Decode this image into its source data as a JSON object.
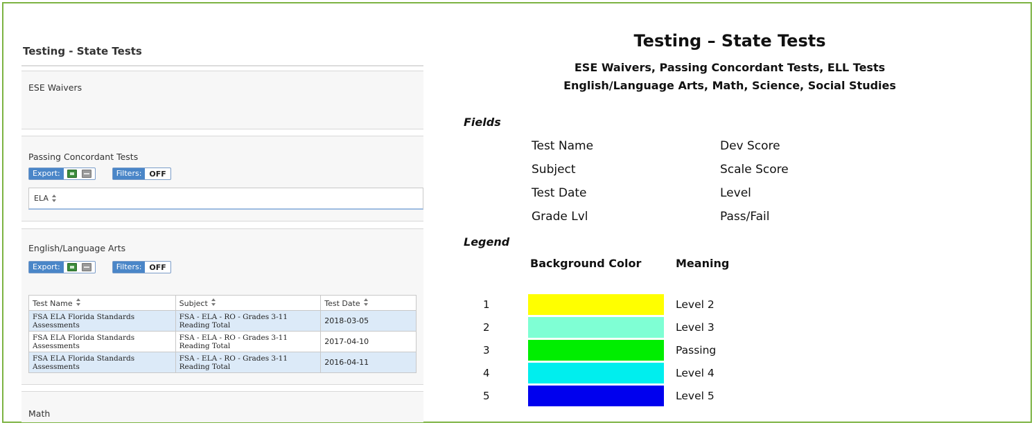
{
  "left_panel": {
    "page_title": "Testing - State Tests",
    "sections": {
      "ese_waivers": {
        "title": "ESE Waivers"
      },
      "passing_concordant": {
        "title": "Passing Concordant Tests",
        "export_label": "Export:",
        "filters_label": "Filters:",
        "filters_value": "OFF",
        "column": "ELA"
      },
      "english": {
        "title": "English/Language Arts",
        "export_label": "Export:",
        "filters_label": "Filters:",
        "filters_value": "OFF",
        "columns": [
          "Test Name",
          "Subject",
          "Test Date"
        ],
        "rows": [
          {
            "test_name": "FSA ELA Florida Standards Assessments",
            "subject": "FSA - ELA - RO - Grades 3-11 Reading Total",
            "test_date": "2018-03-05"
          },
          {
            "test_name": "FSA ELA Florida Standards Assessments",
            "subject": "FSA - ELA - RO - Grades 3-11 Reading Total",
            "test_date": "2017-04-10"
          },
          {
            "test_name": "FSA ELA Florida Standards Assessments",
            "subject": "FSA - ELA - RO - Grades 3-11 Reading Total",
            "test_date": "2016-04-11"
          }
        ]
      },
      "math": {
        "title": "Math"
      }
    },
    "icons": [
      "excel-export-icon",
      "print-icon",
      "sort-icon"
    ]
  },
  "right_panel": {
    "title": "Testing – State Tests",
    "subtitle_1": "ESE Waivers, Passing Concordant Tests, ELL Tests",
    "subtitle_2": "English/Language Arts, Math, Science, Social Studies",
    "fields_heading": "Fields",
    "fields_col1": [
      "Test Name",
      "Subject",
      "Test Date",
      "Grade Lvl"
    ],
    "fields_col2": [
      "Dev Score",
      "Scale Score",
      "Level",
      "Pass/Fail"
    ],
    "legend_heading": "Legend",
    "legend_col_color": "Background Color",
    "legend_col_meaning": "Meaning",
    "legend": [
      {
        "num": "1",
        "color": "#ffff00",
        "meaning": "Level 2"
      },
      {
        "num": "2",
        "color": "#7fffd4",
        "meaning": "Level 3"
      },
      {
        "num": "3",
        "color": "#00ee00",
        "meaning": "Passing"
      },
      {
        "num": "4",
        "color": "#00eeee",
        "meaning": "Level 4"
      },
      {
        "num": "5",
        "color": "#0000ee",
        "meaning": "Level 5"
      }
    ]
  },
  "colors": {
    "frame_border": "#7cb342",
    "export_blue": "#4a86c8",
    "row_highlight": "#dceaf8"
  }
}
